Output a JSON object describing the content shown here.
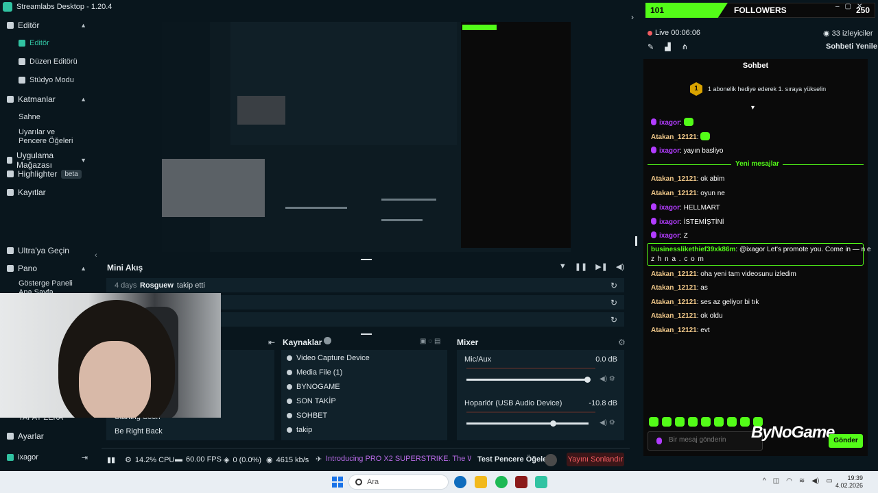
{
  "titlebar": {
    "title": "Streamlabs Desktop - 1.20.4"
  },
  "sidebar": {
    "sections": [
      {
        "label": "Editör"
      },
      {
        "label": "Katmanlar"
      },
      {
        "label": "Uygulama Mağazası"
      },
      {
        "label": "Highlighter",
        "badge": "beta"
      },
      {
        "label": "Kayıtlar"
      },
      {
        "label": "Ultra'ya Geçin"
      },
      {
        "label": "Pano"
      }
    ],
    "editor_items": [
      "Editör",
      "Düzen Editörü",
      "Stüdyo Modu"
    ],
    "layer_items": [
      "Sahne",
      "Uyarılar ve Pencere Öğeleri"
    ],
    "pano_items": [
      "Gösterge Paneli Ana Sayfa",
      "TAPAY ZEKA"
    ],
    "settings": "Ayarlar",
    "user": "ixagor"
  },
  "mini_feed": {
    "title": "Mini Akış",
    "rows": [
      {
        "time": "4 days",
        "user": "Rosguew",
        "action": "takip etti"
      },
      {
        "time": "",
        "user": "",
        "action": ""
      },
      {
        "time": "",
        "user": "",
        "action": ""
      }
    ]
  },
  "scenes": {
    "items": [
      "Starting Soon",
      "Be Right Back"
    ]
  },
  "sources": {
    "title": "Kaynaklar",
    "items": [
      "Video Capture Device",
      "Media File (1)",
      "BYNOGAME",
      "SON TAKİP",
      "SOHBET",
      "takip"
    ]
  },
  "mixer": {
    "title": "Mixer",
    "channels": [
      {
        "name": "Mic/Aux",
        "db": "0.0 dB",
        "level": 0.99
      },
      {
        "name": "Hoparlör (USB Audio Device)",
        "db": "-10.8 dB",
        "level": 0.71
      }
    ]
  },
  "status": {
    "cpu": "14.2% CPU",
    "fps": "60.00 FPS",
    "dropped": "0 (0.0%)",
    "bitrate": "4615 kb/s",
    "ticker": "Introducing PRO X2 SUPERSTRIKE. The Winning C",
    "test_overlay": "Test Pencere Öğeleri",
    "end_stream": "Yayını Sonlandır"
  },
  "chat_panel": {
    "followers": {
      "current": "101",
      "label": "FOLLOWERS",
      "goal": "250",
      "fraction": 0.404
    },
    "live_time": "Live 00:06:06",
    "viewers": "33 izleyiciler",
    "refresh_chat": "Sohbeti Yenile",
    "chat_title": "Sohbet",
    "gift_banner": {
      "rank": "1",
      "text": "1 abonelik hediye ederek 1. sıraya yükselin"
    },
    "new_messages_label": "Yeni mesajlar",
    "messages_before": [
      {
        "user": "ixagor",
        "text": "",
        "emote": true,
        "mic": true
      },
      {
        "user": "Atakan_12121",
        "text": "",
        "emote": true,
        "mic": false
      },
      {
        "user": "ixagor",
        "text": "yayın basliyo",
        "emote": false,
        "mic": true
      }
    ],
    "messages_after": [
      {
        "user": "Atakan_12121",
        "text": "ok abim",
        "mic": false
      },
      {
        "user": "Atakan_12121",
        "text": "oyun ne",
        "mic": false
      },
      {
        "user": "ixagor",
        "text": "HELLMART",
        "mic": true
      },
      {
        "user": "ixagor",
        "text": "İSTEMİŞTİNİ",
        "mic": true
      },
      {
        "user": "ixagor",
        "text": "Z",
        "mic": true
      }
    ],
    "highlight": {
      "user": "businesslikethief39xk86m",
      "text": "@ixagor Let's promote you. Come in — n e",
      "text2": "z h n a . c o m"
    },
    "messages_end": [
      {
        "user": "Atakan_12121",
        "text": "oha yeni tam videosunu izledim"
      },
      {
        "user": "Atakan_12121",
        "text": "as"
      },
      {
        "user": "Atakan_12121",
        "text": "ses az geliyor bi tık"
      },
      {
        "user": "Atakan_12121",
        "text": "ok oldu"
      },
      {
        "user": "Atakan_12121",
        "text": "evt"
      }
    ],
    "input_placeholder": "Bir mesaj gönderin",
    "send": "Gönder",
    "brand": "ByNoGame"
  },
  "taskbar": {
    "search_placeholder": "Ara",
    "time": "19:39",
    "date": "4.02.2026"
  },
  "colors": {
    "accent": "#31c3a2",
    "kick_green": "#53fc18",
    "danger": "#f15c61"
  }
}
